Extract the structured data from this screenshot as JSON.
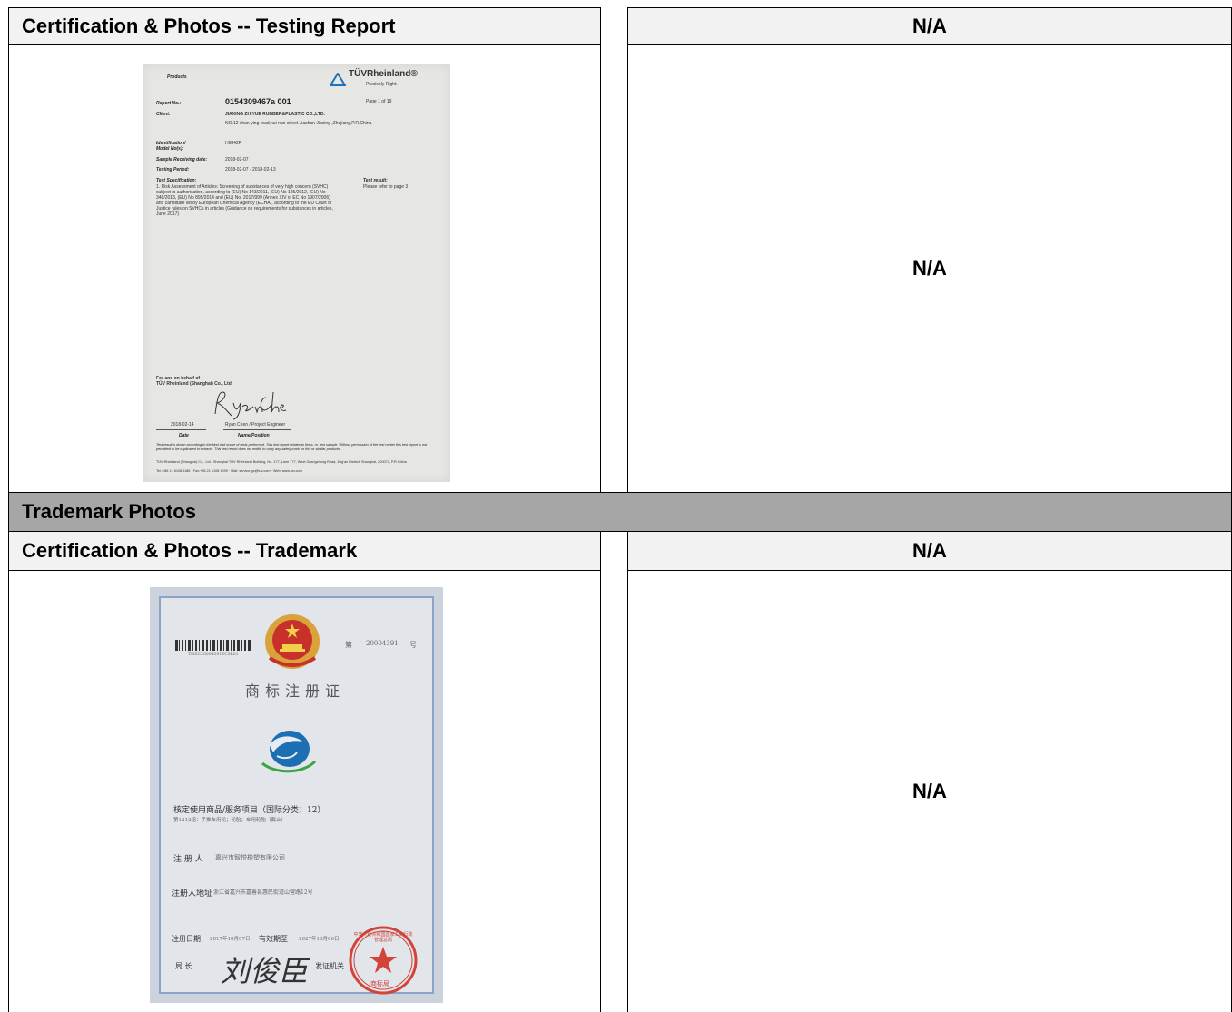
{
  "row1": {
    "left_header": "Certification & Photos -- Testing Report",
    "right_header": "N/A",
    "right_body": "N/A"
  },
  "section": {
    "title": "Trademark Photos"
  },
  "row2": {
    "left_header": "Certification & Photos -- Trademark",
    "right_header": "N/A",
    "right_body": "N/A"
  },
  "tuv_report": {
    "products_label": "Products",
    "brand": "TÜVRheinland®",
    "slogan": "Precisely Right.",
    "report_no_label": "Report No.:",
    "report_no": "0154309467a 001",
    "page": "Page 1 of 19",
    "client_label": "Client:",
    "client_name": "JIAXING ZHIYUE RUBBER&PLASTIC CO.,LTD.",
    "client_address": "NO.12 shan ying road,hui nan street Jiashan Jiaxing ,Zhejiang,P.R.China",
    "identification_label": "Identification/",
    "model_label": "Model No(s):",
    "model": "H6842R",
    "receiving_label": "Sample Receiving date:",
    "receiving_date": "2018-02-07",
    "testing_label": "Testing Period:",
    "testing_period": "2018-02-07 - 2018-02-13",
    "spec_label": "Test Specification:",
    "result_label": "Test result:",
    "result": "Please refer to page 3",
    "spec_text": "1.  Risk Assessment of Articles: Screening of substances of very high concern (SVHC) subject to authorisation, according to (EU) No 143/2011, (EU) No 125/2012, (EU) No 348/2013, (EU) No 895/2014 and (EU) No. 2017/999 (Annex XIV of EC No 1907/2006) and candidate list by European Chemical Agency (ECHA), according to the EU Court of Justice rules on SVHCs in articles (Guidance on requirements for substances in articles, June 2017)",
    "behalf": "For and on behalf of",
    "company": "TÜV Rheinland (Shanghai) Co., Ltd.",
    "signature": "Ryan Chen",
    "sign_date": "2018-02-14",
    "sign_name": "Ryan Chen / Project Engineer",
    "date_label": "Date",
    "name_label": "Name/Position",
    "disclaimer": "Test result is drawn according to the kind and scope of tests performed. This test report relates to the a. m. test sample. Without permission of the test center this test report is not permitted to be duplicated in extracts. This test report does not entitle to carry any safety mark on this or similar products.",
    "footer": "TÜV Rheinland (Shanghai) Co., Ltd., Shanghai TÜV Rheinland Building, No. 177, Lane 777, West Guangzhong Road, Jing'an District, Shanghai, 200072, P.R.China",
    "footer2": "Tel.:+86 21 6108 1188 · Fax:+86 21 6108 1099 · Mail: service-gc@tuv.com · Web: www.tuv.com"
  },
  "trademark_cert": {
    "barcode_text": "TMZC20004391ZCSL01",
    "number_prefix": "第",
    "number": "20004391",
    "number_suffix": "号",
    "title": "商标注册证",
    "goods_label": "核定使用商品/服务项目（国际分类：12）",
    "goods_detail": "第1212组：手推车用轮；轮胎；车用轮胎（截止）",
    "registrant_label": "注 册 人",
    "registrant": "嘉兴市智悦橡塑有限公司",
    "address_label": "注册人地址",
    "address": "浙江省嘉兴市嘉善县惠民街道山营路12号",
    "reg_date_label": "注册日期",
    "reg_date": "2017年10月07日",
    "valid_label": "有效期至",
    "valid_date": "2027年10月06日",
    "director_label": "局  长",
    "director_signature": "刘俊臣",
    "issuer_label": "发证机关",
    "seal_text": "中华人民共和国国家工商行政管理总局",
    "seal_bottom": "商标局"
  },
  "colors": {
    "header_bg": "#f2f2f2",
    "section_bg": "#a6a6a6",
    "border": "#000000"
  }
}
